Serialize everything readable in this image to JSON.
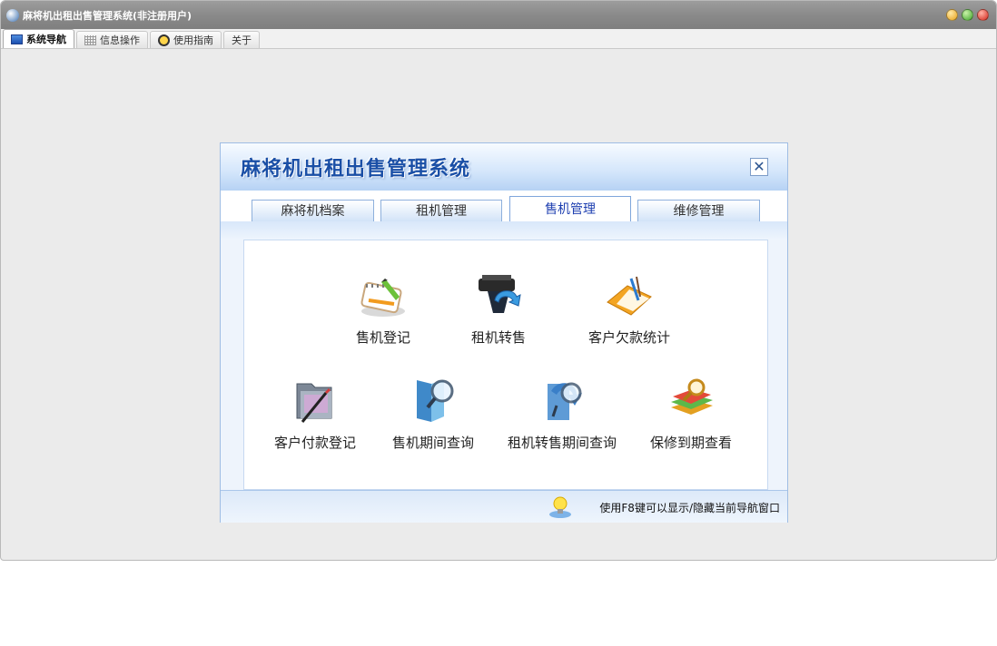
{
  "window": {
    "title": "麻将机出租出售管理系统(非注册用户)",
    "controls": [
      "minimize",
      "maximize",
      "close"
    ]
  },
  "main_tabs": [
    {
      "label": "系统导航",
      "icon": "monitor-icon",
      "active": true
    },
    {
      "label": "信息操作",
      "icon": "grid-icon",
      "active": false
    },
    {
      "label": "使用指南",
      "icon": "help-icon",
      "active": false
    },
    {
      "label": "关于",
      "icon": "",
      "active": false
    }
  ],
  "dialog": {
    "title": "麻将机出租出售管理系统",
    "close_glyph": "✕",
    "tabs": [
      {
        "label": "麻将机档案",
        "active": false
      },
      {
        "label": "租机管理",
        "active": false
      },
      {
        "label": "售机管理",
        "active": true
      },
      {
        "label": "维修管理",
        "active": false
      }
    ],
    "items": [
      {
        "label": "售机登记",
        "icon": "register-notebook-icon"
      },
      {
        "label": "租机转售",
        "icon": "printer-arrow-icon"
      },
      {
        "label": "客户欠款统计",
        "icon": "open-folder-pen-icon"
      },
      {
        "label": "客户付款登记",
        "icon": "folder-pencil-icon"
      },
      {
        "label": "售机期间查询",
        "icon": "book-magnifier-icon"
      },
      {
        "label": "租机转售期间查询",
        "icon": "document-magnifier-icon"
      },
      {
        "label": "保修到期查看",
        "icon": "books-magnifier-icon"
      }
    ],
    "footer_hint": "使用F8键可以显示/隐藏当前导航窗口"
  },
  "colors": {
    "accent": "#1a4fa6",
    "active_tab_text": "#1e3fb0",
    "titlebar": "#8a8a8a"
  }
}
